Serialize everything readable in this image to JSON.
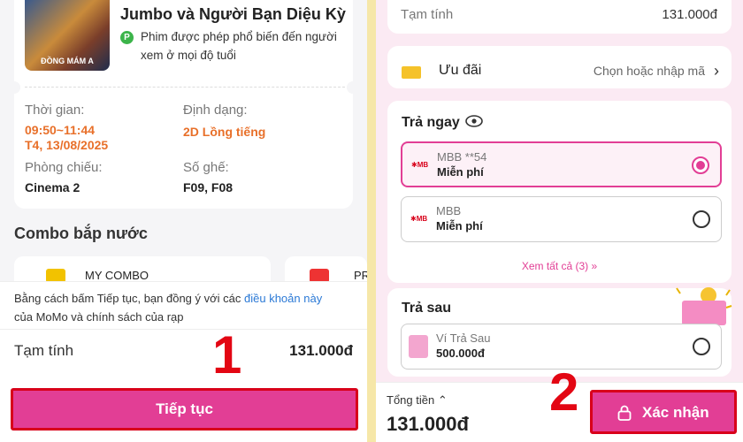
{
  "left": {
    "movie": {
      "title": "Jumbo và Người Bạn Diệu Kỳ",
      "poster_text": "ĐỒNG MÁM A",
      "age_badge": "P",
      "age_desc": "Phim được phép phổ biến đến người xem ở mọi độ tuổi"
    },
    "details": {
      "time_label": "Thời gian:",
      "time_value": "09:50~11:44",
      "date_value": "T4, 13/08/2025",
      "format_label": "Định dạng:",
      "format_value": "2D Lồng tiếng",
      "room_label": "Phòng chiếu:",
      "room_value": "Cinema 2",
      "seat_label": "Số ghế:",
      "seat_value": "F09, F08"
    },
    "combo": {
      "title": "Combo bắp nước",
      "items": [
        "MY COMBO",
        "PR"
      ]
    },
    "terms": {
      "prefix": "Bằng cách bấm Tiếp tục, bạn đồng ý với các ",
      "link": "điều khoản này",
      "suffix": "của MoMo và chính sách của rạp"
    },
    "subtotal_label": "Tạm tính",
    "subtotal_amount": "131.000đ",
    "continue_label": "Tiếp tục",
    "step_number": "1"
  },
  "right": {
    "subtotal_label": "Tạm tính",
    "subtotal_amount": "131.000đ",
    "promo_label": "Ưu đãi",
    "promo_action": "Chọn hoặc nhập mã",
    "pay_now_title": "Trả ngay",
    "methods": [
      {
        "logo": "MB",
        "name": "MBB **54",
        "fee": "Miễn phí",
        "selected": true
      },
      {
        "logo": "MB",
        "name": "MBB",
        "fee": "Miễn phí",
        "selected": false
      }
    ],
    "see_all": "Xem tất cả (3) »",
    "pay_later_title": "Trả sau",
    "later_method": {
      "name": "Ví Trả Sau",
      "amount": "500.000đ",
      "selected": false
    },
    "total_label": "Tổng tiền",
    "total_amount": "131.000đ",
    "confirm_label": "Xác nhận",
    "step_number": "2"
  },
  "colors": {
    "brand_pink": "#e23e95",
    "annotation_red": "#e30613",
    "accent_orange": "#e8702a"
  }
}
